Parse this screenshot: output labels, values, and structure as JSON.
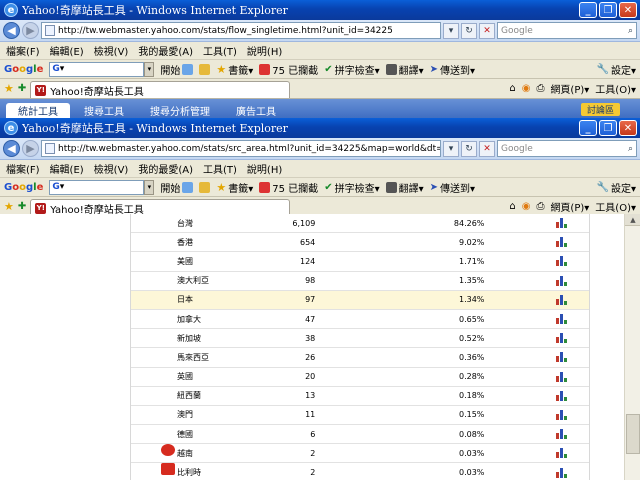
{
  "back_window": {
    "title": "Yahoo!奇摩站長工具 - Windows Internet Explorer",
    "address": "http://tw.webmaster.yahoo.com/stats/flow_singletime.html?unit_id=34225",
    "search_placeholder": "Google",
    "menu": [
      "檔案(F)",
      "編輯(E)",
      "檢視(V)",
      "我的最愛(A)",
      "工具(T)",
      "說明(H)"
    ],
    "google_buttons": [
      "開始",
      "書籤▾",
      "75 已攔截",
      "拼字檢查▾",
      "翻譯▾",
      "傳送到▾"
    ],
    "settings_label": "設定▾",
    "tab_title": "Yahoo!奇摩站長工具",
    "cmd_page": "網頁(P)▾",
    "cmd_tools": "工具(O)▾",
    "site_tabs": [
      "統計工具",
      "搜尋工具",
      "搜尋分析管理",
      "廣告工具"
    ],
    "forum_label": "討論區"
  },
  "front_window": {
    "title": "Yahoo!奇摩站長工具 - Windows Internet Explorer",
    "address": "http://tw.webmaster.yahoo.com/stats/src_area.html?unit_id=34225&map=world&dt=yesterday",
    "search_placeholder": "Google",
    "menu": [
      "檔案(F)",
      "編輯(E)",
      "檢視(V)",
      "我的最愛(A)",
      "工具(T)",
      "說明(H)"
    ],
    "google_buttons": [
      "開始",
      "書籤▾",
      "75 已攔截",
      "拼字檢查▾",
      "翻譯▾",
      "傳送到▾"
    ],
    "settings_label": "設定▾",
    "tab_title": "Yahoo!奇摩站長工具",
    "cmd_page": "網頁(P)▾",
    "cmd_tools": "工具(O)▾"
  },
  "google_label": "Google",
  "table_rows": [
    {
      "country": "台灣",
      "count": "6,109",
      "percent": "84.26%"
    },
    {
      "country": "香港",
      "count": "654",
      "percent": "9.02%"
    },
    {
      "country": "美國",
      "count": "124",
      "percent": "1.71%"
    },
    {
      "country": "澳大利亞",
      "count": "98",
      "percent": "1.35%"
    },
    {
      "country": "日本",
      "count": "97",
      "percent": "1.34%",
      "highlight": true
    },
    {
      "country": "加拿大",
      "count": "47",
      "percent": "0.65%"
    },
    {
      "country": "新加坡",
      "count": "38",
      "percent": "0.52%"
    },
    {
      "country": "馬來西亞",
      "count": "26",
      "percent": "0.36%"
    },
    {
      "country": "英國",
      "count": "20",
      "percent": "0.28%"
    },
    {
      "country": "紐西蘭",
      "count": "13",
      "percent": "0.18%"
    },
    {
      "country": "澳門",
      "count": "11",
      "percent": "0.15%"
    },
    {
      "country": "德國",
      "count": "6",
      "percent": "0.08%"
    },
    {
      "country": "越南",
      "count": "2",
      "percent": "0.03%",
      "flag": "vn"
    },
    {
      "country": "比利時",
      "count": "2",
      "percent": "0.03%",
      "flag": "be"
    }
  ],
  "colors": {
    "title_blue": "#0842b0",
    "bar_red": "#c0392b",
    "bar_blue": "#2b4fb3",
    "bar_green": "#2e8b3a"
  }
}
